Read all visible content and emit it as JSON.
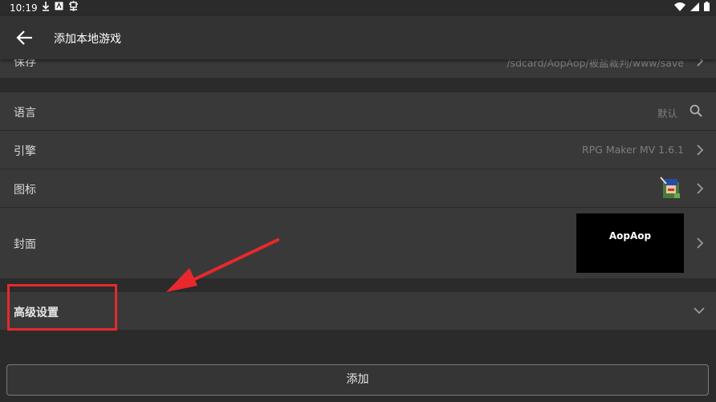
{
  "status_bar": {
    "time": "10:19",
    "left_icons": [
      "download-icon",
      "app-notification-icon",
      "bug-icon"
    ],
    "right_icons": [
      "wifi-icon",
      "cell-signal-icon",
      "battery-icon"
    ]
  },
  "app_bar": {
    "title": "添加本地游戏",
    "back_icon": "arrow-left-icon"
  },
  "settings": {
    "save": {
      "label": "保存",
      "value": "/sdcard/AopAop/被盐裁判/www/save"
    },
    "language": {
      "label": "语言",
      "value": "默认"
    },
    "engine": {
      "label": "引擎",
      "value": "RPG Maker MV 1.6.1"
    },
    "icon": {
      "label": "图标"
    },
    "cover": {
      "label": "封面",
      "image_text": "AopAop"
    },
    "advanced": {
      "label": "高级设置"
    }
  },
  "add_button": {
    "label": "添加"
  },
  "colors": {
    "background": "#2b2b2b",
    "row": "#393939",
    "app_bar": "#333333",
    "annotation": "#e8282c"
  }
}
